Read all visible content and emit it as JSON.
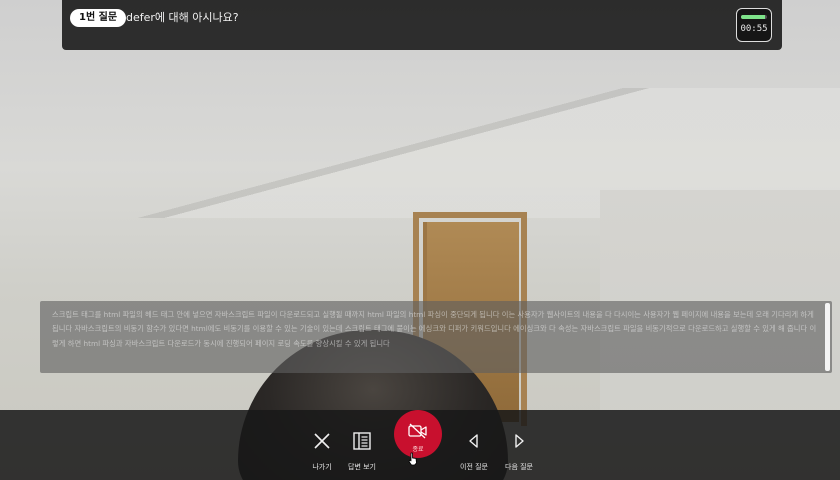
{
  "question": {
    "badge": "1번 질문",
    "text": "defer에 대해 아시나요?"
  },
  "timer": {
    "time": "00:55",
    "progress": 0.92,
    "color": "#7ee38a"
  },
  "answer": {
    "text": "스크립트 태그를 html 파일의 헤드 태그 안에 넣으면 자바스크립트 파일이 다운로드되고 실행될 때까지 html 파일의 html 파싱이 중단되게 됩니다 이는 사용자가 웹사이트의 내용을 다 다시이는 사용자가 웹 페이지에 내용을 보는데 오래 기다리게 하게 됩니다 자바스크립트의 비동기 함수가 있다면 html에도 비동기를 이용할 수 있는 기술이 있는데 스크립트 태그에 붙이는 에싱크와 디퍼가 키워드입니다 에이싱크와 다 속성는 자바스크립트 파일을 비동기적으로 다운로드하고 실행할 수 있게 해 줍니다 이렇게 하면 html 파싱과 자바스크립트 다운로드가 동시에 진행되어 페이지 로딩 속도를 향상시킬 수 있게 됩니다"
  },
  "controls": {
    "exit": {
      "label": "나가기",
      "icon": "close-icon"
    },
    "view_answer": {
      "label": "답변 보기",
      "icon": "document-icon"
    },
    "record": {
      "label": "종료",
      "icon": "video-off-icon",
      "color": "#c8102e"
    },
    "prev": {
      "label": "이전 질문",
      "icon": "chevron-left-icon"
    },
    "next": {
      "label": "다음 질문",
      "icon": "chevron-right-icon"
    }
  }
}
